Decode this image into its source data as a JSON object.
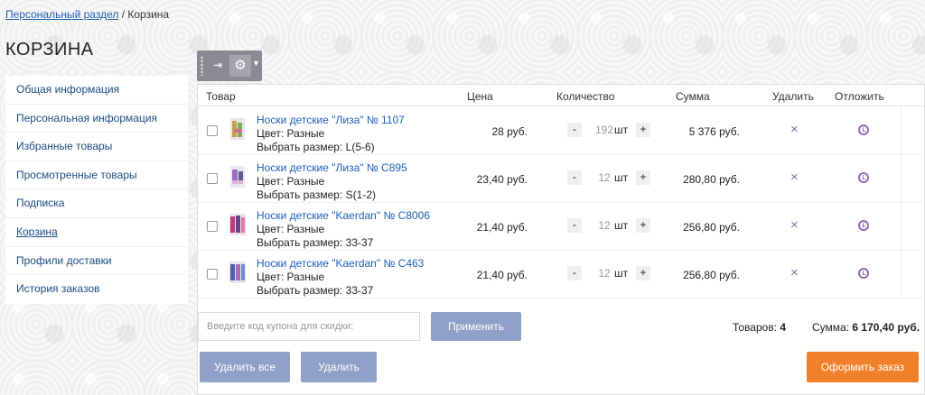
{
  "breadcrumb": {
    "link": "Персональный раздел",
    "sep": " / ",
    "current": "Корзина"
  },
  "page_title": "КОРЗИНА",
  "sidebar": {
    "items": [
      {
        "label": "Общая информация"
      },
      {
        "label": "Персональная информация"
      },
      {
        "label": "Избранные товары"
      },
      {
        "label": "Просмотренные товары"
      },
      {
        "label": "Подписка"
      },
      {
        "label": "Корзина"
      },
      {
        "label": "Профили доставки"
      },
      {
        "label": "История заказов"
      }
    ]
  },
  "toolbar": {
    "pin_icon": "pin-icon",
    "gear_icon": "gear-icon"
  },
  "columns": {
    "product": "Товар",
    "price": "Цена",
    "qty": "Количество",
    "sum": "Сумма",
    "delete": "Удалить",
    "later": "Отложить"
  },
  "rows": [
    {
      "name": "Носки детские \"Лиза\" № 1107",
      "color": "Цвет: Разные",
      "size": "Выбрать размер: L(5-6)",
      "price": "28 руб.",
      "qty": "192",
      "unit": "шт",
      "sum": "5 376 руб."
    },
    {
      "name": "Носки детские \"Лиза\" № C895",
      "color": "Цвет: Разные",
      "size": "Выбрать размер: S(1-2)",
      "price": "23,40 руб.",
      "qty": "12",
      "unit": "шт",
      "sum": "280,80 руб."
    },
    {
      "name": "Носки детские \"Kaerdan\" № C8006",
      "color": "Цвет: Разные",
      "size": "Выбрать размер: 33-37",
      "price": "21,40 руб.",
      "qty": "12",
      "unit": "шт",
      "sum": "256,80 руб."
    },
    {
      "name": "Носки детские \"Kaerdan\" № C463",
      "color": "Цвет: Разные",
      "size": "Выбрать размер: 33-37",
      "price": "21,40 руб.",
      "qty": "12",
      "unit": "шт",
      "sum": "256,80 руб."
    }
  ],
  "qty_minus": "-",
  "qty_plus": "+",
  "delete_symbol": "×",
  "coupon": {
    "placeholder": "Введите код купона для скидки:",
    "apply": "Применить"
  },
  "totals": {
    "items_label": "Товаров:",
    "items_count": "4",
    "sum_label": "Сумма:",
    "sum_value": "6 170,40 руб."
  },
  "buttons": {
    "delete_all": "Удалить все",
    "delete": "Удалить",
    "checkout": "Оформить заказ"
  },
  "colors": {
    "link": "#1a5fb4",
    "accent": "#8e6bb0",
    "button_blue": "#8fa1c9",
    "checkout": "#f08029"
  }
}
